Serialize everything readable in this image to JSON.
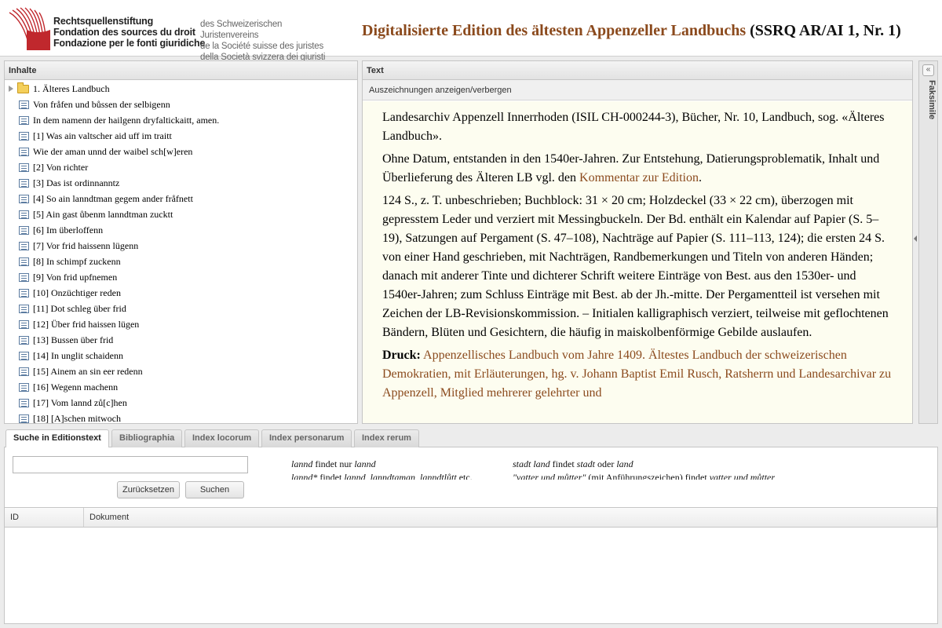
{
  "header": {
    "logo_names": [
      "Rechtsquellenstiftung",
      "Fondation des sources du droit",
      "Fondazione per le fonti giuridiche"
    ],
    "logo_sub": [
      "des Schweizerischen Juristenvereins",
      "de la Société suisse des juristes",
      "della Società svizzera dei giuristi"
    ],
    "title": "Digitalisierte Edition des ältesten Appenzeller Landbuchs",
    "title_tail": "(SSRQ AR/AI 1, Nr. 1)"
  },
  "toc": {
    "heading": "Inhalte",
    "root": "1. Älteres Landbuch",
    "items": [
      "Von fråfen und bůssen der selbigenn",
      "In dem namenn der hailgenn dryfaltickaitt, amen.",
      "[1] Was ain valtscher aid uff im traitt",
      "Wie der aman unnd der waibel sch[w]eren",
      "[2] Von richter",
      "[3] Das ist ordinnanntz",
      "[4] So ain lanndtman gegem ander fråfnett",
      "[5] Ain gast ůbenm lanndtman zucktt",
      "[6] Im überloffenn",
      "[7] Vor frid haissenn lügenn",
      "[8] In schimpf zuckenn",
      "[9] Von frid upfnemen",
      "[10] Onzüchtiger reden",
      "[11] Dot schleg über frid",
      "[12] Über frid haissen lügen",
      "[13] Bussen über frid",
      "[14] In unglit schaidenn",
      "[15] Ainem an sin eer redenn",
      "[16] Wegenn machenn",
      "[17] Vom lannd zů[c]hen",
      "[18] [A]schen mitwoch"
    ]
  },
  "text_panel": {
    "heading": "Text",
    "toggle_label": "Auszeichnungen anzeigen/verbergen",
    "p1": "Landesarchiv Appenzell Innerrhoden (ISIL CH-000244-3), Bücher, Nr. 10, Landbuch, sog. «Älteres Landbuch».",
    "p2_before": "Ohne Datum, entstanden in den 1540er-Jahren. Zur Entstehung, Datierungsproblematik, Inhalt und Überlieferung des Älteren LB vgl. den ",
    "p2_link": "Kommentar zur Edition",
    "p2_after": ".",
    "p3": "124 S., z. T. unbeschrieben; Buchblock: 31 × 20 cm; Holzdeckel (33 × 22 cm), überzogen mit gepresstem Leder und verziert mit Messingbuckeln. Der Bd. enthält ein Kalendar auf Papier (S. 5–19), Satzungen auf Pergament (S. 47–108), Nachträge auf Papier (S. 111–113, 124); die ersten 24 S. von einer Hand geschrieben, mit Nachträgen, Randbemerkungen und Titeln von anderen Händen; danach mit anderer Tinte und dichterer Schrift weitere Einträge von Best. aus den 1530er- und 1540er-Jahren; zum Schluss Einträge mit Best. ab der Jh.-mitte. Der Pergamentteil ist versehen mit Zeichen der LB-Revisionskommission. – Initialen kalligraphisch verziert, teilweise mit geflochtenen Bändern, Blüten und Gesichtern, die häufig in maiskolbenförmige Gebilde auslaufen.",
    "druck_label": "Druck:",
    "druck_link": "Appenzellisches Landbuch vom Jahre 1409. Ältestes Landbuch der schweizerischen Demokratien, mit Erläuterungen, hg. v. Johann Baptist Emil Rusch, Ratsherrn und Landesarchivar zu Appenzell, Mitglied mehrerer gelehrter und"
  },
  "facsimile": {
    "label": "Faksimile",
    "collapse_glyph": "«"
  },
  "tabs": [
    "Suche in Editionstext",
    "Bibliographia",
    "Index locorum",
    "Index personarum",
    "Index rerum"
  ],
  "search": {
    "input_value": "",
    "reset_label": "Zurücksetzen",
    "search_label": "Suchen",
    "hint1_term": "lannd",
    "hint1_mid": " findet nur ",
    "hint1_result": "lannd",
    "hint2_term": "lannd*",
    "hint2_mid": " findet ",
    "hint2_result": "lannd, lanndtaman, lanndtlůtt",
    "hint2_tail": " etc.",
    "hint3_a": "stadt land",
    "hint3_mid": " findet ",
    "hint3_b": "stadt",
    "hint3_or": " oder ",
    "hint3_c": "land",
    "hint4_a": "\"vatter und můtter\"",
    "hint4_mid": " (mit Anführungszeichen) findet ",
    "hint4_b": "vatter und můtter"
  },
  "results": {
    "columns": [
      "ID",
      "Dokument"
    ]
  }
}
